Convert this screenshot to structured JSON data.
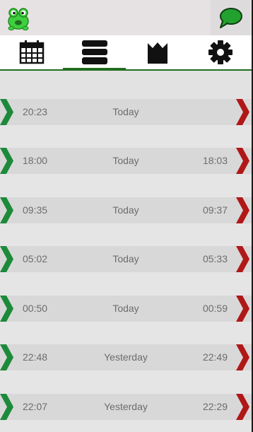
{
  "app": {
    "icon": "frog-icon",
    "chat_icon": "chat-bubble-icon"
  },
  "tabs": [
    {
      "name": "calendar",
      "icon": "calendar-icon"
    },
    {
      "name": "list",
      "icon": "stack-icon",
      "selected": true
    },
    {
      "name": "crown",
      "icon": "crown-icon"
    },
    {
      "name": "settings",
      "icon": "gear-icon"
    }
  ],
  "colors": {
    "accent_green": "#1f6e1f",
    "chevron_green": "#1c8a3a",
    "chevron_red": "#b01818"
  },
  "rows": [
    {
      "start": "20:23",
      "day": "Today",
      "end": ""
    },
    {
      "start": "18:00",
      "day": "Today",
      "end": "18:03"
    },
    {
      "start": "09:35",
      "day": "Today",
      "end": "09:37"
    },
    {
      "start": "05:02",
      "day": "Today",
      "end": "05:33"
    },
    {
      "start": "00:50",
      "day": "Today",
      "end": "00:59"
    },
    {
      "start": "22:48",
      "day": "Yesterday",
      "end": "22:49"
    },
    {
      "start": "22:07",
      "day": "Yesterday",
      "end": "22:29"
    }
  ]
}
